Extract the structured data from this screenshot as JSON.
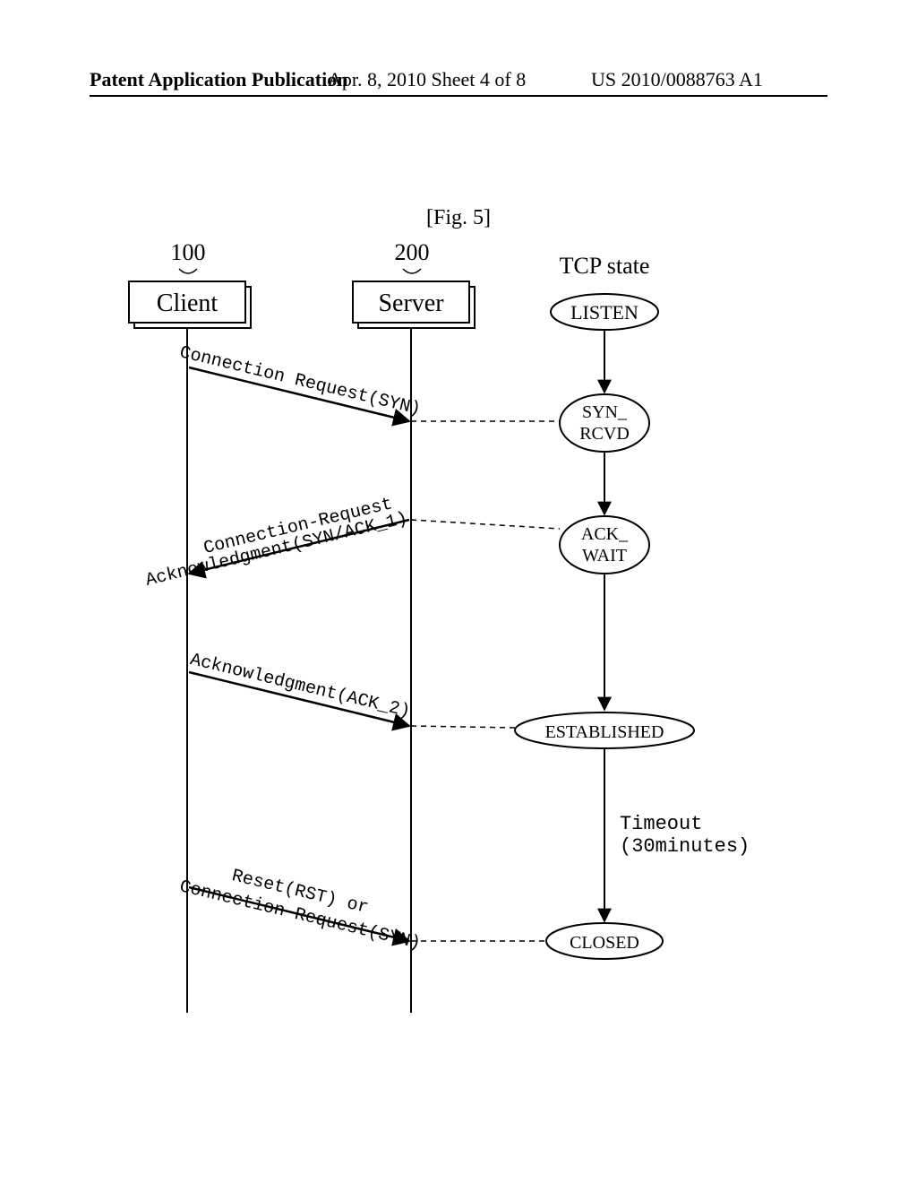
{
  "header": {
    "left": "Patent Application Publication",
    "middle": "Apr. 8, 2010  Sheet 4 of 8",
    "right": "US 2010/0088763 A1"
  },
  "figure_label": "[Fig. 5]",
  "participants": {
    "client": {
      "ref": "100",
      "label": "Client"
    },
    "server": {
      "ref": "200",
      "label": "Server"
    }
  },
  "tcp_state_heading": "TCP state",
  "states": {
    "listen": "LISTEN",
    "syn_rcvd_l1": "SYN_",
    "syn_rcvd_l2": "RCVD",
    "ack_wait_l1": "ACK_",
    "ack_wait_l2": "WAIT",
    "established": "ESTABLISHED",
    "closed": "CLOSED"
  },
  "messages": {
    "m1": "Connection Request(SYN)",
    "m2a": "Connection-Request",
    "m2b": "Acknowledgment(SYN/ACK_1)",
    "m3": "Acknowledgment(ACK_2)",
    "m4a": "Reset(RST) or",
    "m4b": "Connection Request(SYN)"
  },
  "timeout": {
    "l1": "Timeout",
    "l2": "(30minutes)"
  },
  "chart_data": {
    "type": "sequence",
    "participants": [
      "Client",
      "Server"
    ],
    "participant_refs": {
      "Client": "100",
      "Server": "200"
    },
    "state_column_title": "TCP state",
    "states_in_order": [
      "LISTEN",
      "SYN_RCVD",
      "ACK_WAIT",
      "ESTABLISHED",
      "CLOSED"
    ],
    "messages": [
      {
        "from": "Client",
        "to": "Server",
        "label": "Connection Request(SYN)",
        "causes_state": "SYN_RCVD"
      },
      {
        "from": "Server",
        "to": "Client",
        "label": "Connection-Request Acknowledgment(SYN/ACK_1)",
        "causes_state": "ACK_WAIT"
      },
      {
        "from": "Client",
        "to": "Server",
        "label": "Acknowledgment(ACK_2)",
        "causes_state": "ESTABLISHED"
      },
      {
        "from": "Client",
        "to": "Server",
        "label": "Reset(RST) or Connection Request(SYN)",
        "causes_state": "CLOSED"
      }
    ],
    "timeout": {
      "after_state": "ESTABLISHED",
      "label": "Timeout (30minutes)",
      "leads_to": "CLOSED"
    }
  }
}
